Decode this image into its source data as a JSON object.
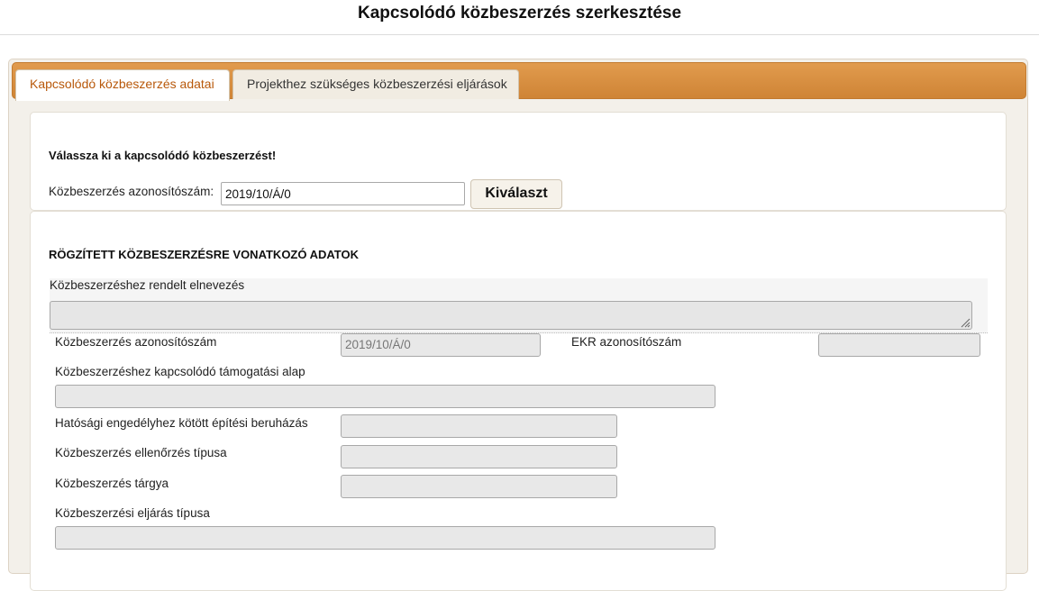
{
  "header": {
    "title": "Kapcsolódó közbeszerzés szerkesztése"
  },
  "tabs": [
    {
      "label": "Kapcsolódó közbeszerzés adatai",
      "active": true
    },
    {
      "label": "Projekthez szükséges közbeszerzési eljárások",
      "active": false
    }
  ],
  "select_section": {
    "heading": "Válassza ki a kapcsolódó közbeszerzést!",
    "id_label": "Közbeszerzés azonosítószám:",
    "id_value": "2019/10/Á/0",
    "select_button": "Kiválaszt"
  },
  "data_section": {
    "heading": "RÖGZÍTETT KÖZBESZERZÉSRE VONATKOZÓ ADATOK",
    "name_label": "Közbeszerzéshez rendelt elnevezés",
    "name_value": "",
    "id_label": "Közbeszerzés azonosítószám",
    "id_value": "2019/10/Á/0",
    "ekr_label": "EKR azonosítószám",
    "ekr_value": "",
    "fund_label": "Közbeszerzéshez kapcsolódó támogatási alap",
    "fund_value": "",
    "permit_label": "Hatósági engedélyhez kötött építési beruházás",
    "permit_value": "",
    "control_label": "Közbeszerzés ellenőrzés típusa",
    "control_value": "",
    "subject_label": "Közbeszerzés tárgya",
    "subject_value": "",
    "procedure_label": "Közbeszerzési eljárás típusa",
    "procedure_value": ""
  },
  "colors": {
    "tab_bar": "#d68b3d",
    "active_tab_text": "#b8580a",
    "readonly_bg": "#e8e8e8"
  },
  "icons": {
    "resize_grip": "resize-grip-icon"
  }
}
